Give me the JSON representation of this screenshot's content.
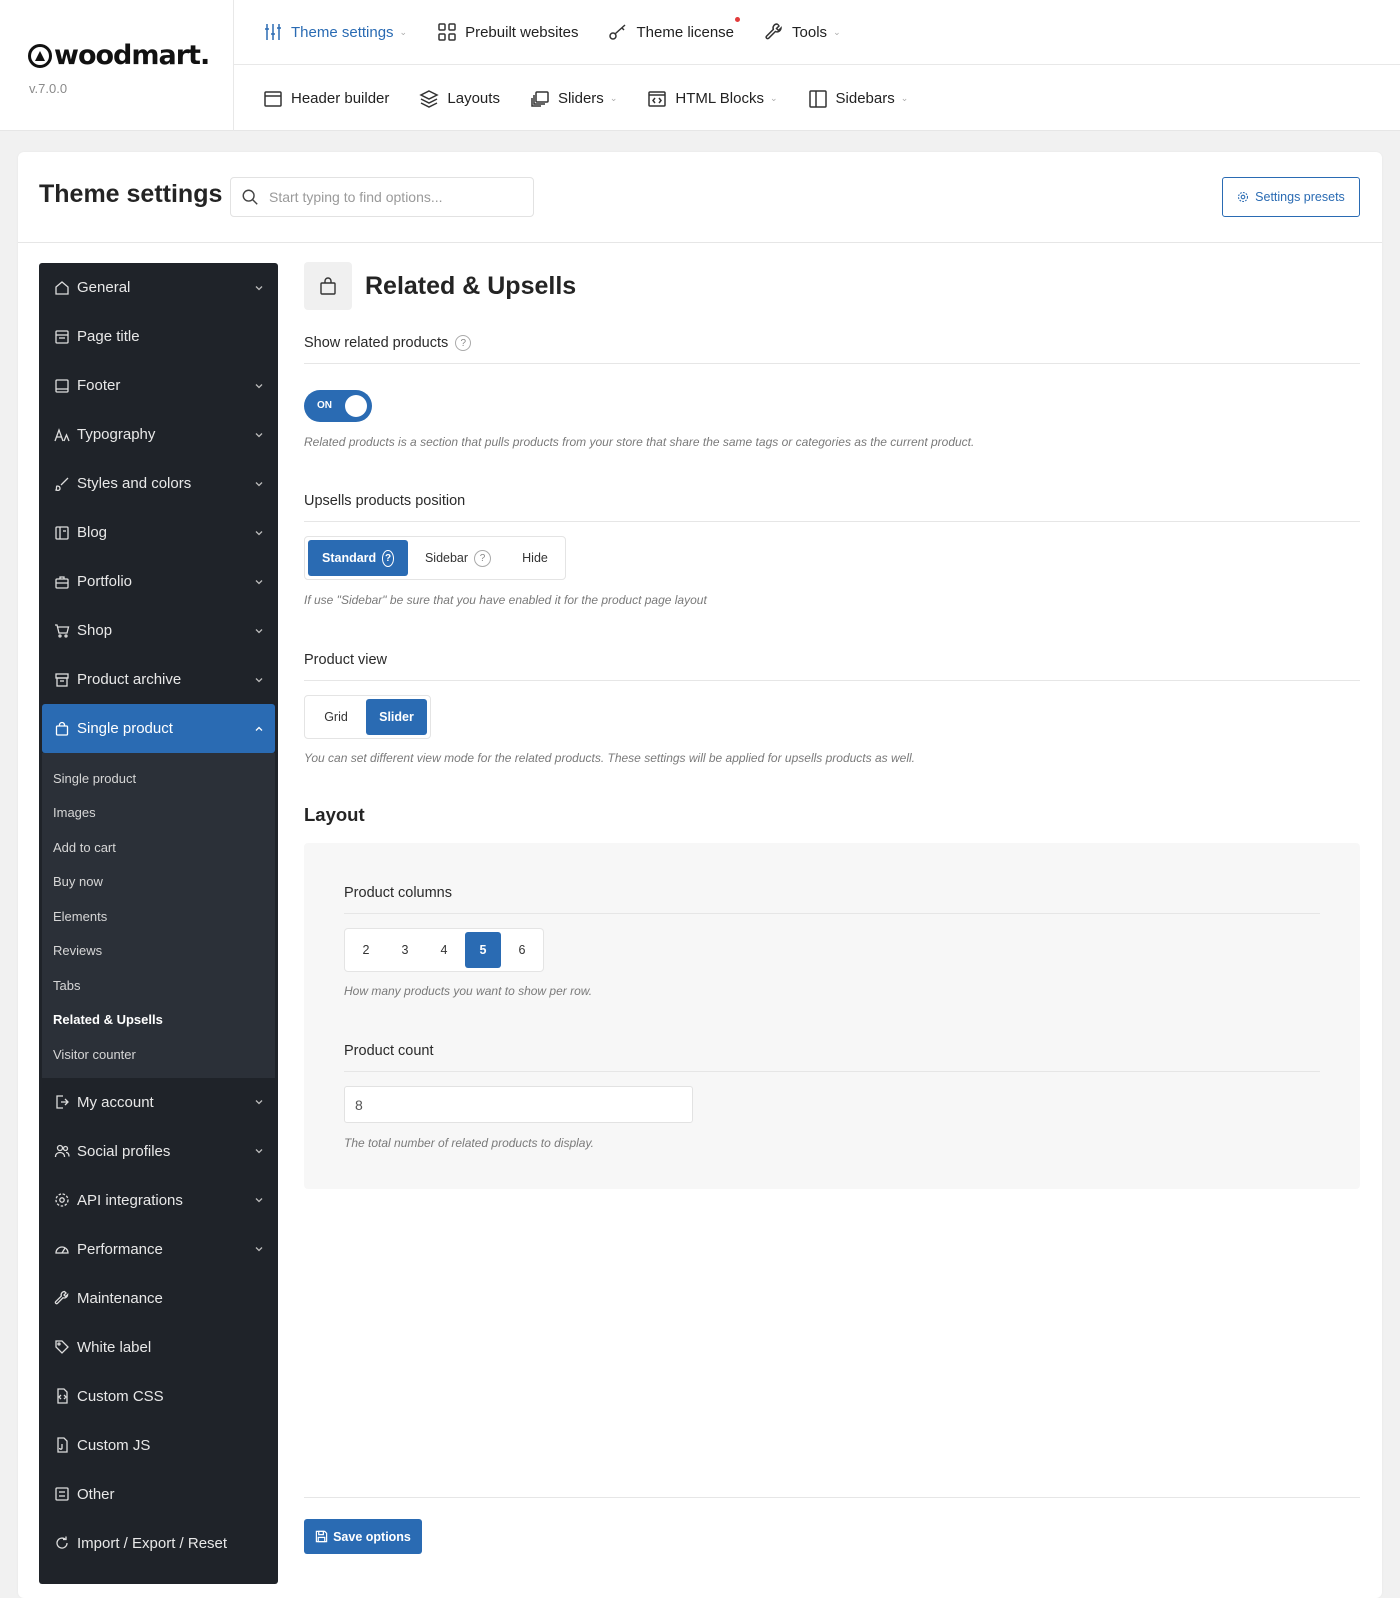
{
  "brand": {
    "name": "woodmart.",
    "version": "v.7.0.0"
  },
  "topnav": {
    "row1": [
      {
        "label": "Theme settings",
        "icon": "sliders-icon",
        "caret": true,
        "active": true
      },
      {
        "label": "Prebuilt websites",
        "icon": "grid-icon",
        "caret": false
      },
      {
        "label": "Theme license",
        "icon": "key-icon",
        "caret": false,
        "dot": true
      },
      {
        "label": "Tools",
        "icon": "wrench-icon",
        "caret": true
      }
    ],
    "row2": [
      {
        "label": "Header builder",
        "icon": "window-icon",
        "caret": false
      },
      {
        "label": "Layouts",
        "icon": "layers-icon",
        "caret": false
      },
      {
        "label": "Sliders",
        "icon": "slides-icon",
        "caret": true
      },
      {
        "label": "HTML Blocks",
        "icon": "code-block-icon",
        "caret": true
      },
      {
        "label": "Sidebars",
        "icon": "sidebar-icon",
        "caret": true
      }
    ]
  },
  "header": {
    "title": "Theme settings",
    "search_placeholder": "Start typing to find options...",
    "presets_label": "Settings presets"
  },
  "sidebar": {
    "items_top": [
      {
        "label": "General",
        "icon": "home-icon",
        "chevron": true
      },
      {
        "label": "Page title",
        "icon": "page-title-icon",
        "chevron": false
      },
      {
        "label": "Footer",
        "icon": "footer-icon",
        "chevron": true
      },
      {
        "label": "Typography",
        "icon": "typography-icon",
        "chevron": true
      },
      {
        "label": "Styles and colors",
        "icon": "brush-icon",
        "chevron": true
      },
      {
        "label": "Blog",
        "icon": "blog-icon",
        "chevron": true
      },
      {
        "label": "Portfolio",
        "icon": "briefcase-icon",
        "chevron": true
      },
      {
        "label": "Shop",
        "icon": "cart-icon",
        "chevron": true
      },
      {
        "label": "Product archive",
        "icon": "archive-icon",
        "chevron": true
      }
    ],
    "open_item": {
      "label": "Single product",
      "icon": "bag-icon"
    },
    "sub_items": [
      "Single product",
      "Images",
      "Add to cart",
      "Buy now",
      "Elements",
      "Reviews",
      "Tabs",
      "Related & Upsells",
      "Visitor counter"
    ],
    "current_sub": "Related & Upsells",
    "items_bottom": [
      {
        "label": "My account",
        "icon": "account-icon",
        "chevron": true
      },
      {
        "label": "Social profiles",
        "icon": "users-icon",
        "chevron": true
      },
      {
        "label": "API integrations",
        "icon": "gear-icon",
        "chevron": true
      },
      {
        "label": "Performance",
        "icon": "gauge-icon",
        "chevron": true
      },
      {
        "label": "Maintenance",
        "icon": "wrench-icon",
        "chevron": false
      },
      {
        "label": "White label",
        "icon": "tag-icon",
        "chevron": false
      },
      {
        "label": "Custom CSS",
        "icon": "css-file-icon",
        "chevron": false
      },
      {
        "label": "Custom JS",
        "icon": "js-file-icon",
        "chevron": false
      },
      {
        "label": "Other",
        "icon": "other-icon",
        "chevron": false
      },
      {
        "label": "Import / Export / Reset",
        "icon": "refresh-icon",
        "chevron": false
      }
    ]
  },
  "section": {
    "title": "Related & Upsells",
    "icon": "bag-icon",
    "show_related": {
      "label": "Show related products",
      "toggle_label": "ON",
      "on": true,
      "hint": "Related products is a section that pulls products from your store that share the same tags or categories as the current product."
    },
    "upsells_position": {
      "label": "Upsells products position",
      "options": [
        "Standard",
        "Sidebar",
        "Hide"
      ],
      "selected": "Standard",
      "hint": "If use \"Sidebar\" be sure that you have enabled it for the product page layout"
    },
    "product_view": {
      "label": "Product view",
      "options": [
        "Grid",
        "Slider"
      ],
      "selected": "Slider",
      "hint": "You can set different view mode for the related products. These settings will be applied for upsells products as well."
    },
    "layout": {
      "title": "Layout",
      "columns": {
        "label": "Product columns",
        "options": [
          "2",
          "3",
          "4",
          "5",
          "6"
        ],
        "selected": "5",
        "hint": "How many products you want to show per row."
      },
      "count": {
        "label": "Product count",
        "value": "8",
        "hint": "The total number of related products to display."
      }
    },
    "save_label": "Save options"
  },
  "colors": {
    "accent": "#2a6bb3",
    "sidebar_bg": "#1f2329",
    "sub_bg": "#2b3038"
  }
}
